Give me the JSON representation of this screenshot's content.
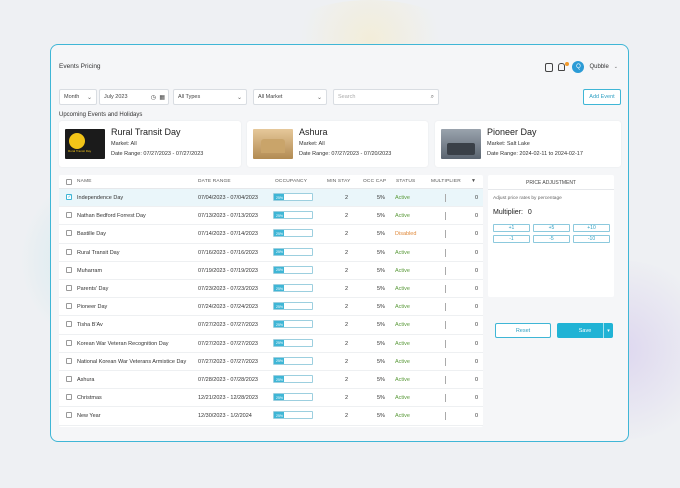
{
  "app": {
    "title": "Events Pricing",
    "user_name": "Qubble",
    "user_initial": "Q"
  },
  "filters": {
    "period": "Month",
    "date": "July 2023",
    "type": "All Types",
    "market": "All Market",
    "search_placeholder": "Search",
    "add_event": "Add Event"
  },
  "upcoming": {
    "label": "Upcoming Events and Holidays",
    "cards": [
      {
        "name": "Rural Transit Day",
        "market": "Market: All",
        "range": "Date Range: 07/27/2023 - 07/27/2023",
        "thumb_text": "Rural Transit Day"
      },
      {
        "name": "Ashura",
        "market": "Market: All",
        "range": "Date Range: 07/27/2023 - 07/20/2023"
      },
      {
        "name": "Pioneer Day",
        "market": "Market: Salt Lake",
        "range": "Date Range: 2024-02-11 to 2024-02-17"
      }
    ]
  },
  "table": {
    "headers": {
      "name": "NAME",
      "range": "DATE RANGE",
      "occupancy": "OCCUPANCY",
      "minstay": "MIN STAY",
      "occcap": "OCC CAP",
      "status": "STATUS",
      "multiplier": "MULTIPLIER"
    },
    "rows": [
      {
        "name": "Independence Day",
        "range": "07/04/2023 - 07/04/2023",
        "occ": "25%",
        "min": "2",
        "cap": "5%",
        "status": "Active",
        "mult": "0",
        "selected": true
      },
      {
        "name": "Nathan Bedford Forrest Day",
        "range": "07/13/2023 - 07/13/2023",
        "occ": "25%",
        "min": "2",
        "cap": "5%",
        "status": "Active",
        "mult": "0"
      },
      {
        "name": "Bastille Day",
        "range": "07/14/2023 - 07/14/2023",
        "occ": "25%",
        "min": "2",
        "cap": "5%",
        "status": "Disabled",
        "mult": "0"
      },
      {
        "name": "Rural Transit Day",
        "range": "07/16/2023 - 07/16/2023",
        "occ": "25%",
        "min": "2",
        "cap": "5%",
        "status": "Active",
        "mult": "0"
      },
      {
        "name": "Muharram",
        "range": "07/19/2023 - 07/19/2023",
        "occ": "25%",
        "min": "2",
        "cap": "5%",
        "status": "Active",
        "mult": "0"
      },
      {
        "name": "Parents' Day",
        "range": "07/23/2023 - 07/23/2023",
        "occ": "25%",
        "min": "2",
        "cap": "5%",
        "status": "Active",
        "mult": "0"
      },
      {
        "name": "Pioneer Day",
        "range": "07/24/2023 - 07/24/2023",
        "occ": "25%",
        "min": "2",
        "cap": "5%",
        "status": "Active",
        "mult": "0"
      },
      {
        "name": "Tisha B'Av",
        "range": "07/27/2023 - 07/27/2023",
        "occ": "25%",
        "min": "2",
        "cap": "5%",
        "status": "Active",
        "mult": "0"
      },
      {
        "name": "Korean War Veteran Recognition Day",
        "range": "07/27/2023 - 07/27/2023",
        "occ": "25%",
        "min": "2",
        "cap": "5%",
        "status": "Active",
        "mult": "0"
      },
      {
        "name": "National Korean War Veterans Armistice Day",
        "range": "07/27/2023 - 07/27/2023",
        "occ": "25%",
        "min": "2",
        "cap": "5%",
        "status": "Active",
        "mult": "0"
      },
      {
        "name": "Ashura",
        "range": "07/28/2023 - 07/28/2023",
        "occ": "25%",
        "min": "2",
        "cap": "5%",
        "status": "Active",
        "mult": "0"
      },
      {
        "name": "Christmas",
        "range": "12/21/2023 - 12/28/2023",
        "occ": "25%",
        "min": "2",
        "cap": "5%",
        "status": "Active",
        "mult": "0"
      },
      {
        "name": "New Year",
        "range": "12/30/2023 - 1/2/2024",
        "occ": "25%",
        "min": "2",
        "cap": "5%",
        "status": "Active",
        "mult": "0"
      }
    ]
  },
  "price_adjustment": {
    "title": "PRICE ADJUSTMENT",
    "description": "Adjust price rates by percentage",
    "multiplier_label": "Multiplier:",
    "multiplier_value": "0",
    "buttons": [
      "+1",
      "+5",
      "+10",
      "-1",
      "-5",
      "-10"
    ]
  },
  "actions": {
    "reset": "Reset",
    "save": "Save"
  },
  "colors": {
    "accent": "#3fb6d6",
    "active": "#5a9a3a",
    "disabled": "#e08a3c"
  }
}
